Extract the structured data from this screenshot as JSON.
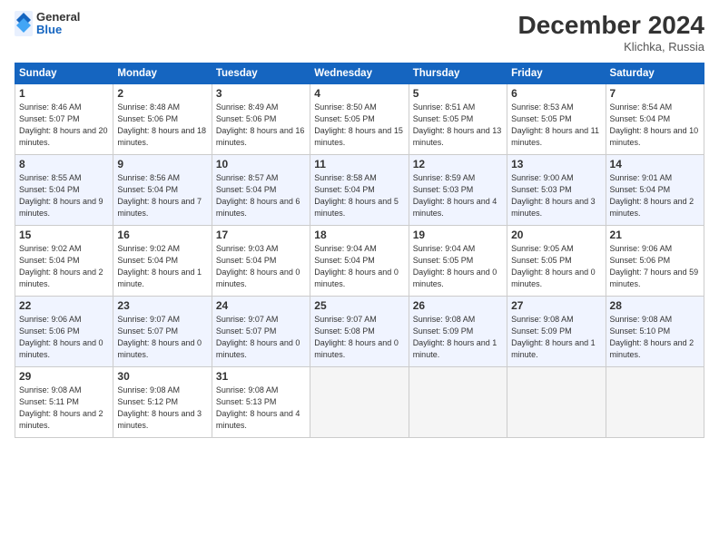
{
  "header": {
    "logo_general": "General",
    "logo_blue": "Blue",
    "month_title": "December 2024",
    "location": "Klichka, Russia"
  },
  "weekdays": [
    "Sunday",
    "Monday",
    "Tuesday",
    "Wednesday",
    "Thursday",
    "Friday",
    "Saturday"
  ],
  "rows": [
    [
      {
        "day": "1",
        "sunrise": "Sunrise: 8:46 AM",
        "sunset": "Sunset: 5:07 PM",
        "daylight": "Daylight: 8 hours and 20 minutes."
      },
      {
        "day": "2",
        "sunrise": "Sunrise: 8:48 AM",
        "sunset": "Sunset: 5:06 PM",
        "daylight": "Daylight: 8 hours and 18 minutes."
      },
      {
        "day": "3",
        "sunrise": "Sunrise: 8:49 AM",
        "sunset": "Sunset: 5:06 PM",
        "daylight": "Daylight: 8 hours and 16 minutes."
      },
      {
        "day": "4",
        "sunrise": "Sunrise: 8:50 AM",
        "sunset": "Sunset: 5:05 PM",
        "daylight": "Daylight: 8 hours and 15 minutes."
      },
      {
        "day": "5",
        "sunrise": "Sunrise: 8:51 AM",
        "sunset": "Sunset: 5:05 PM",
        "daylight": "Daylight: 8 hours and 13 minutes."
      },
      {
        "day": "6",
        "sunrise": "Sunrise: 8:53 AM",
        "sunset": "Sunset: 5:05 PM",
        "daylight": "Daylight: 8 hours and 11 minutes."
      },
      {
        "day": "7",
        "sunrise": "Sunrise: 8:54 AM",
        "sunset": "Sunset: 5:04 PM",
        "daylight": "Daylight: 8 hours and 10 minutes."
      }
    ],
    [
      {
        "day": "8",
        "sunrise": "Sunrise: 8:55 AM",
        "sunset": "Sunset: 5:04 PM",
        "daylight": "Daylight: 8 hours and 9 minutes."
      },
      {
        "day": "9",
        "sunrise": "Sunrise: 8:56 AM",
        "sunset": "Sunset: 5:04 PM",
        "daylight": "Daylight: 8 hours and 7 minutes."
      },
      {
        "day": "10",
        "sunrise": "Sunrise: 8:57 AM",
        "sunset": "Sunset: 5:04 PM",
        "daylight": "Daylight: 8 hours and 6 minutes."
      },
      {
        "day": "11",
        "sunrise": "Sunrise: 8:58 AM",
        "sunset": "Sunset: 5:04 PM",
        "daylight": "Daylight: 8 hours and 5 minutes."
      },
      {
        "day": "12",
        "sunrise": "Sunrise: 8:59 AM",
        "sunset": "Sunset: 5:03 PM",
        "daylight": "Daylight: 8 hours and 4 minutes."
      },
      {
        "day": "13",
        "sunrise": "Sunrise: 9:00 AM",
        "sunset": "Sunset: 5:03 PM",
        "daylight": "Daylight: 8 hours and 3 minutes."
      },
      {
        "day": "14",
        "sunrise": "Sunrise: 9:01 AM",
        "sunset": "Sunset: 5:04 PM",
        "daylight": "Daylight: 8 hours and 2 minutes."
      }
    ],
    [
      {
        "day": "15",
        "sunrise": "Sunrise: 9:02 AM",
        "sunset": "Sunset: 5:04 PM",
        "daylight": "Daylight: 8 hours and 2 minutes."
      },
      {
        "day": "16",
        "sunrise": "Sunrise: 9:02 AM",
        "sunset": "Sunset: 5:04 PM",
        "daylight": "Daylight: 8 hours and 1 minute."
      },
      {
        "day": "17",
        "sunrise": "Sunrise: 9:03 AM",
        "sunset": "Sunset: 5:04 PM",
        "daylight": "Daylight: 8 hours and 0 minutes."
      },
      {
        "day": "18",
        "sunrise": "Sunrise: 9:04 AM",
        "sunset": "Sunset: 5:04 PM",
        "daylight": "Daylight: 8 hours and 0 minutes."
      },
      {
        "day": "19",
        "sunrise": "Sunrise: 9:04 AM",
        "sunset": "Sunset: 5:05 PM",
        "daylight": "Daylight: 8 hours and 0 minutes."
      },
      {
        "day": "20",
        "sunrise": "Sunrise: 9:05 AM",
        "sunset": "Sunset: 5:05 PM",
        "daylight": "Daylight: 8 hours and 0 minutes."
      },
      {
        "day": "21",
        "sunrise": "Sunrise: 9:06 AM",
        "sunset": "Sunset: 5:06 PM",
        "daylight": "Daylight: 7 hours and 59 minutes."
      }
    ],
    [
      {
        "day": "22",
        "sunrise": "Sunrise: 9:06 AM",
        "sunset": "Sunset: 5:06 PM",
        "daylight": "Daylight: 8 hours and 0 minutes."
      },
      {
        "day": "23",
        "sunrise": "Sunrise: 9:07 AM",
        "sunset": "Sunset: 5:07 PM",
        "daylight": "Daylight: 8 hours and 0 minutes."
      },
      {
        "day": "24",
        "sunrise": "Sunrise: 9:07 AM",
        "sunset": "Sunset: 5:07 PM",
        "daylight": "Daylight: 8 hours and 0 minutes."
      },
      {
        "day": "25",
        "sunrise": "Sunrise: 9:07 AM",
        "sunset": "Sunset: 5:08 PM",
        "daylight": "Daylight: 8 hours and 0 minutes."
      },
      {
        "day": "26",
        "sunrise": "Sunrise: 9:08 AM",
        "sunset": "Sunset: 5:09 PM",
        "daylight": "Daylight: 8 hours and 1 minute."
      },
      {
        "day": "27",
        "sunrise": "Sunrise: 9:08 AM",
        "sunset": "Sunset: 5:09 PM",
        "daylight": "Daylight: 8 hours and 1 minute."
      },
      {
        "day": "28",
        "sunrise": "Sunrise: 9:08 AM",
        "sunset": "Sunset: 5:10 PM",
        "daylight": "Daylight: 8 hours and 2 minutes."
      }
    ],
    [
      {
        "day": "29",
        "sunrise": "Sunrise: 9:08 AM",
        "sunset": "Sunset: 5:11 PM",
        "daylight": "Daylight: 8 hours and 2 minutes."
      },
      {
        "day": "30",
        "sunrise": "Sunrise: 9:08 AM",
        "sunset": "Sunset: 5:12 PM",
        "daylight": "Daylight: 8 hours and 3 minutes."
      },
      {
        "day": "31",
        "sunrise": "Sunrise: 9:08 AM",
        "sunset": "Sunset: 5:13 PM",
        "daylight": "Daylight: 8 hours and 4 minutes."
      },
      null,
      null,
      null,
      null
    ]
  ]
}
